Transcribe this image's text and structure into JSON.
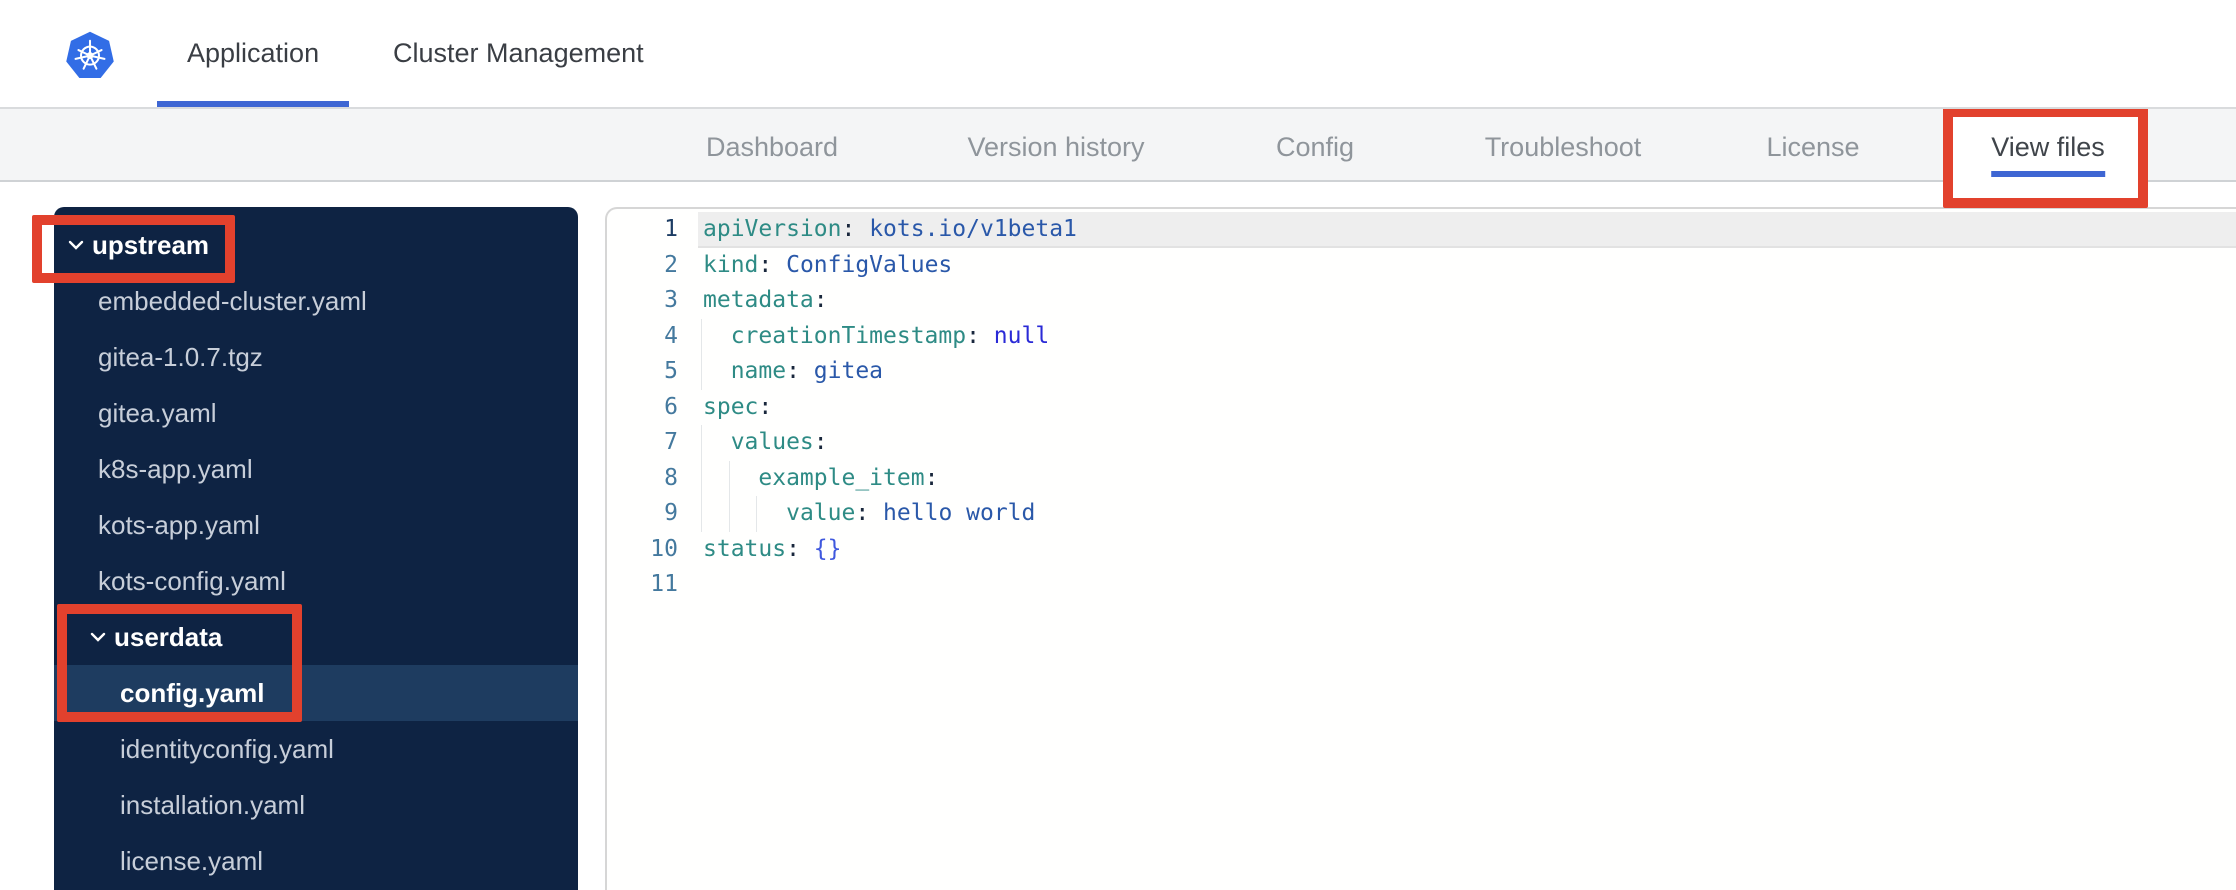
{
  "topnav": {
    "tabs": [
      {
        "label": "Application",
        "active": true
      },
      {
        "label": "Cluster Management",
        "active": false
      }
    ]
  },
  "subnav": {
    "tabs": [
      {
        "label": "Dashboard",
        "active": false
      },
      {
        "label": "Version history",
        "active": false
      },
      {
        "label": "Config",
        "active": false
      },
      {
        "label": "Troubleshoot",
        "active": false
      },
      {
        "label": "License",
        "active": false
      },
      {
        "label": "View files",
        "active": true
      }
    ]
  },
  "sidebar": {
    "items": [
      {
        "label": "upstream",
        "type": "folder",
        "level": 0,
        "expanded": true
      },
      {
        "label": "embedded-cluster.yaml",
        "type": "file",
        "level": 1
      },
      {
        "label": "gitea-1.0.7.tgz",
        "type": "file",
        "level": 1
      },
      {
        "label": "gitea.yaml",
        "type": "file",
        "level": 1
      },
      {
        "label": "k8s-app.yaml",
        "type": "file",
        "level": 1
      },
      {
        "label": "kots-app.yaml",
        "type": "file",
        "level": 1
      },
      {
        "label": "kots-config.yaml",
        "type": "file",
        "level": 1
      },
      {
        "label": "userdata",
        "type": "folder",
        "level": 1,
        "expanded": true
      },
      {
        "label": "config.yaml",
        "type": "file",
        "level": 2,
        "selected": true
      },
      {
        "label": "identityconfig.yaml",
        "type": "file",
        "level": 2
      },
      {
        "label": "installation.yaml",
        "type": "file",
        "level": 2
      },
      {
        "label": "license.yaml",
        "type": "file",
        "level": 2
      }
    ]
  },
  "editor": {
    "language": "yaml",
    "active_line": 1,
    "lines": [
      {
        "num": "1",
        "tokens": [
          {
            "c": "key",
            "v": "apiVersion"
          },
          {
            "c": "punc",
            "v": ":"
          },
          {
            "c": "str",
            "v": " kots.io/v1beta1"
          }
        ]
      },
      {
        "num": "2",
        "tokens": [
          {
            "c": "key",
            "v": "kind"
          },
          {
            "c": "punc",
            "v": ":"
          },
          {
            "c": "str",
            "v": " ConfigValues"
          }
        ]
      },
      {
        "num": "3",
        "tokens": [
          {
            "c": "key",
            "v": "metadata"
          },
          {
            "c": "punc",
            "v": ":"
          }
        ]
      },
      {
        "num": "4",
        "tokens": [
          {
            "c": "key",
            "v": "creationTimestamp"
          },
          {
            "c": "punc",
            "v": ":"
          },
          {
            "c": "kw",
            "v": " null"
          }
        ]
      },
      {
        "num": "5",
        "tokens": [
          {
            "c": "key",
            "v": "name"
          },
          {
            "c": "punc",
            "v": ":"
          },
          {
            "c": "str",
            "v": " gitea"
          }
        ]
      },
      {
        "num": "6",
        "tokens": [
          {
            "c": "key",
            "v": "spec"
          },
          {
            "c": "punc",
            "v": ":"
          }
        ]
      },
      {
        "num": "7",
        "tokens": [
          {
            "c": "key",
            "v": "values"
          },
          {
            "c": "punc",
            "v": ":"
          }
        ]
      },
      {
        "num": "8",
        "tokens": [
          {
            "c": "key",
            "v": "example_item"
          },
          {
            "c": "punc",
            "v": ":"
          }
        ]
      },
      {
        "num": "9",
        "tokens": [
          {
            "c": "key",
            "v": "value"
          },
          {
            "c": "punc",
            "v": ":"
          },
          {
            "c": "str",
            "v": " hello world"
          }
        ]
      },
      {
        "num": "10",
        "tokens": [
          {
            "c": "key",
            "v": "status"
          },
          {
            "c": "punc",
            "v": ":"
          },
          {
            "c": "brace",
            "v": " {}"
          }
        ]
      },
      {
        "num": "11",
        "tokens": []
      }
    ]
  },
  "annotations": {
    "color": "#e2412d",
    "boxes": [
      "upstream-folder",
      "userdata-and-config-yaml",
      "view-files-tab"
    ]
  },
  "colors": {
    "kubernetes_blue": "#326de6",
    "active_underline_blue": "#3e66d3",
    "annotation_red": "#e2412d",
    "sidebar_bg": "#0e2343",
    "sidebar_selected_bg": "#1e3c60",
    "sidebar_file_text": "#c7ced9",
    "subnav_bg": "#f4f5f6",
    "token_key": "#2e8b85",
    "token_string": "#2a58a9",
    "token_keyword": "#2a2ad6",
    "line_number": "#44799e",
    "active_line_highlight": "#eeeeee"
  }
}
